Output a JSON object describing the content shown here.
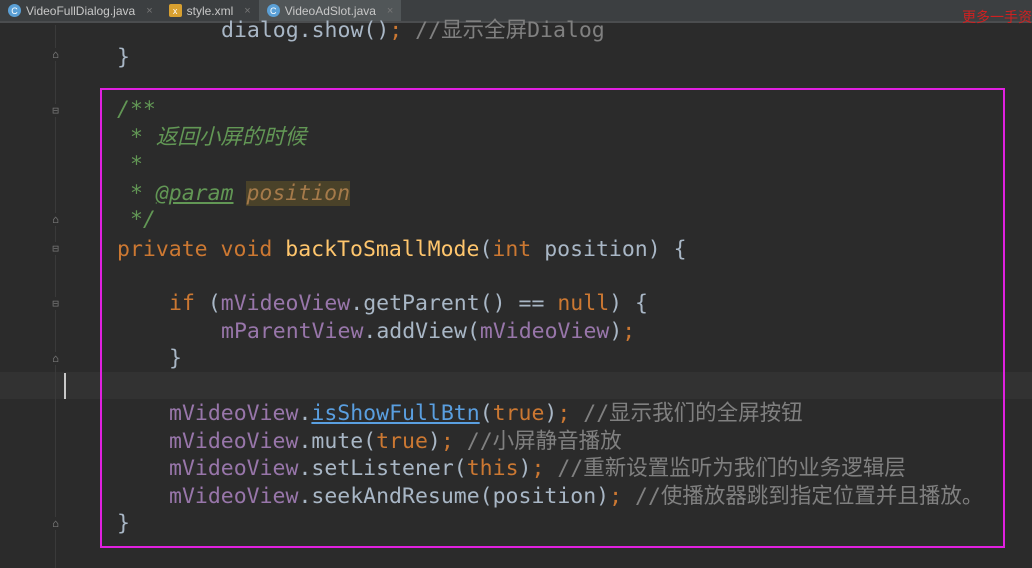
{
  "tabs": [
    {
      "label": "VideoFullDialog.java",
      "icon": "C",
      "close": "×"
    },
    {
      "label": "style.xml",
      "icon": "x",
      "close": "×"
    },
    {
      "label": "VideoAdSlot.java",
      "icon": "C",
      "close": "×",
      "active": true
    }
  ],
  "watermark": "更多一手资",
  "code": [
    {
      "indent": 4,
      "tokens": [
        [
          "dialog.show()",
          ""
        ],
        [
          ";",
          "kw"
        ],
        [
          " //显示全屏Dialog",
          "cm"
        ]
      ]
    },
    {
      "indent": 0,
      "tokens": [
        [
          "}",
          ""
        ]
      ]
    },
    {
      "indent": 0,
      "tokens": []
    },
    {
      "indent": 0,
      "tokens": [
        [
          "/**",
          "doc"
        ]
      ]
    },
    {
      "indent": 0,
      "tokens": [
        [
          " * 返回小屏的时候",
          "doc"
        ]
      ]
    },
    {
      "indent": 0,
      "tokens": [
        [
          " *",
          "doc"
        ]
      ]
    },
    {
      "indent": 0,
      "tokens": [
        [
          " * ",
          "doc"
        ],
        [
          "@param",
          "doctag"
        ],
        [
          " ",
          "doc"
        ],
        [
          "position",
          "docparam"
        ]
      ]
    },
    {
      "indent": 0,
      "tokens": [
        [
          " */",
          "doc"
        ]
      ]
    },
    {
      "indent": 0,
      "tokens": [
        [
          "private void ",
          "kw"
        ],
        [
          "backToSmallMode",
          "fn"
        ],
        [
          "(",
          ""
        ],
        [
          "int ",
          "kw"
        ],
        [
          "position) {",
          ""
        ]
      ]
    },
    {
      "indent": 0,
      "tokens": []
    },
    {
      "indent": 2,
      "tokens": [
        [
          "if ",
          "kw"
        ],
        [
          "(",
          ""
        ],
        [
          "mVideoView",
          "fld"
        ],
        [
          ".getParent() == ",
          ""
        ],
        [
          "null",
          "kw"
        ],
        [
          ") {",
          ""
        ]
      ]
    },
    {
      "indent": 4,
      "tokens": [
        [
          "mParentView",
          "fld"
        ],
        [
          ".addView(",
          ""
        ],
        [
          "mVideoView",
          "fld"
        ],
        [
          ")",
          ""
        ],
        [
          ";",
          "kw"
        ]
      ]
    },
    {
      "indent": 2,
      "tokens": [
        [
          "}",
          ""
        ]
      ]
    },
    {
      "indent": 0,
      "tokens": []
    },
    {
      "indent": 2,
      "tokens": [
        [
          "mVideoView",
          "fld"
        ],
        [
          ".",
          ""
        ],
        [
          "isShowFullBtn",
          "link"
        ],
        [
          "(",
          ""
        ],
        [
          "true",
          "kw"
        ],
        [
          ")",
          ""
        ],
        [
          ";",
          "kw"
        ],
        [
          " //显示我们的全屏按钮",
          "cm"
        ]
      ]
    },
    {
      "indent": 2,
      "tokens": [
        [
          "mVideoView",
          "fld"
        ],
        [
          ".mute(",
          ""
        ],
        [
          "true",
          "kw"
        ],
        [
          ")",
          ""
        ],
        [
          ";",
          "kw"
        ],
        [
          " //小屏静音播放",
          "cm"
        ]
      ]
    },
    {
      "indent": 2,
      "tokens": [
        [
          "mVideoView",
          "fld"
        ],
        [
          ".setListener(",
          ""
        ],
        [
          "this",
          "kw"
        ],
        [
          ")",
          ""
        ],
        [
          ";",
          "kw"
        ],
        [
          " //重新设置监听为我们的业务逻辑层",
          "cm"
        ]
      ]
    },
    {
      "indent": 2,
      "tokens": [
        [
          "mVideoView",
          "fld"
        ],
        [
          ".seekAndResume(position)",
          ""
        ],
        [
          ";",
          "kw"
        ],
        [
          " //使播放器跳到指定位置并且播放。",
          "cm"
        ]
      ]
    },
    {
      "indent": 0,
      "tokens": [
        [
          "}",
          ""
        ]
      ]
    }
  ]
}
